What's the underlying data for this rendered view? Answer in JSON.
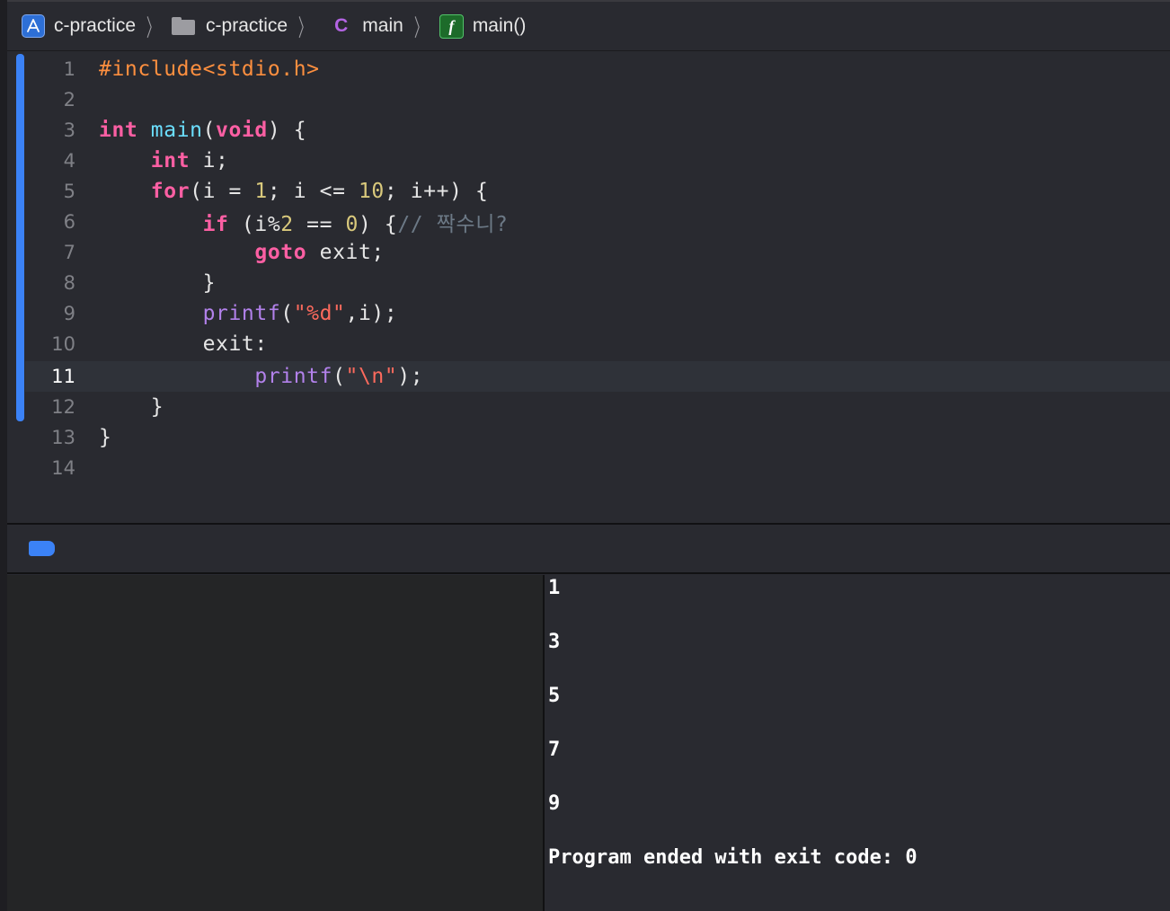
{
  "breadcrumb": {
    "project_icon": "xcode-project-icon",
    "project": "c-practice",
    "folder_icon": "folder-icon",
    "folder": "c-practice",
    "file_icon_letter": "C",
    "file": "main",
    "function_icon_letter": "f",
    "function": "main()"
  },
  "editor": {
    "current_line": 11,
    "line_numbers": [
      "1",
      "2",
      "3",
      "4",
      "5",
      "6",
      "7",
      "8",
      "9",
      "10",
      "11",
      "12",
      "13",
      "14"
    ],
    "code_lines": [
      "#include<stdio.h>",
      "",
      "int main(void) {",
      "    int i;",
      "    for(i = 1; i <= 10; i++) {",
      "        if (i%2 == 0) {// 짝수니?",
      "            goto exit;",
      "        }",
      "        printf(\"%d\",i);",
      "        exit:",
      "            printf(\"\\n\");",
      "    }",
      "}",
      ""
    ]
  },
  "console": {
    "lines": [
      "1",
      "3",
      "5",
      "7",
      "9",
      "Program ended with exit code: 0"
    ]
  },
  "colors": {
    "keyword": "#fc5fa3",
    "function_decl": "#6bdfff",
    "function_call": "#b281eb",
    "number": "#d9c97c",
    "string": "#fc6a5d",
    "preprocessor": "#fd8f3f",
    "comment": "#6c7986",
    "accent": "#3b82f6"
  }
}
